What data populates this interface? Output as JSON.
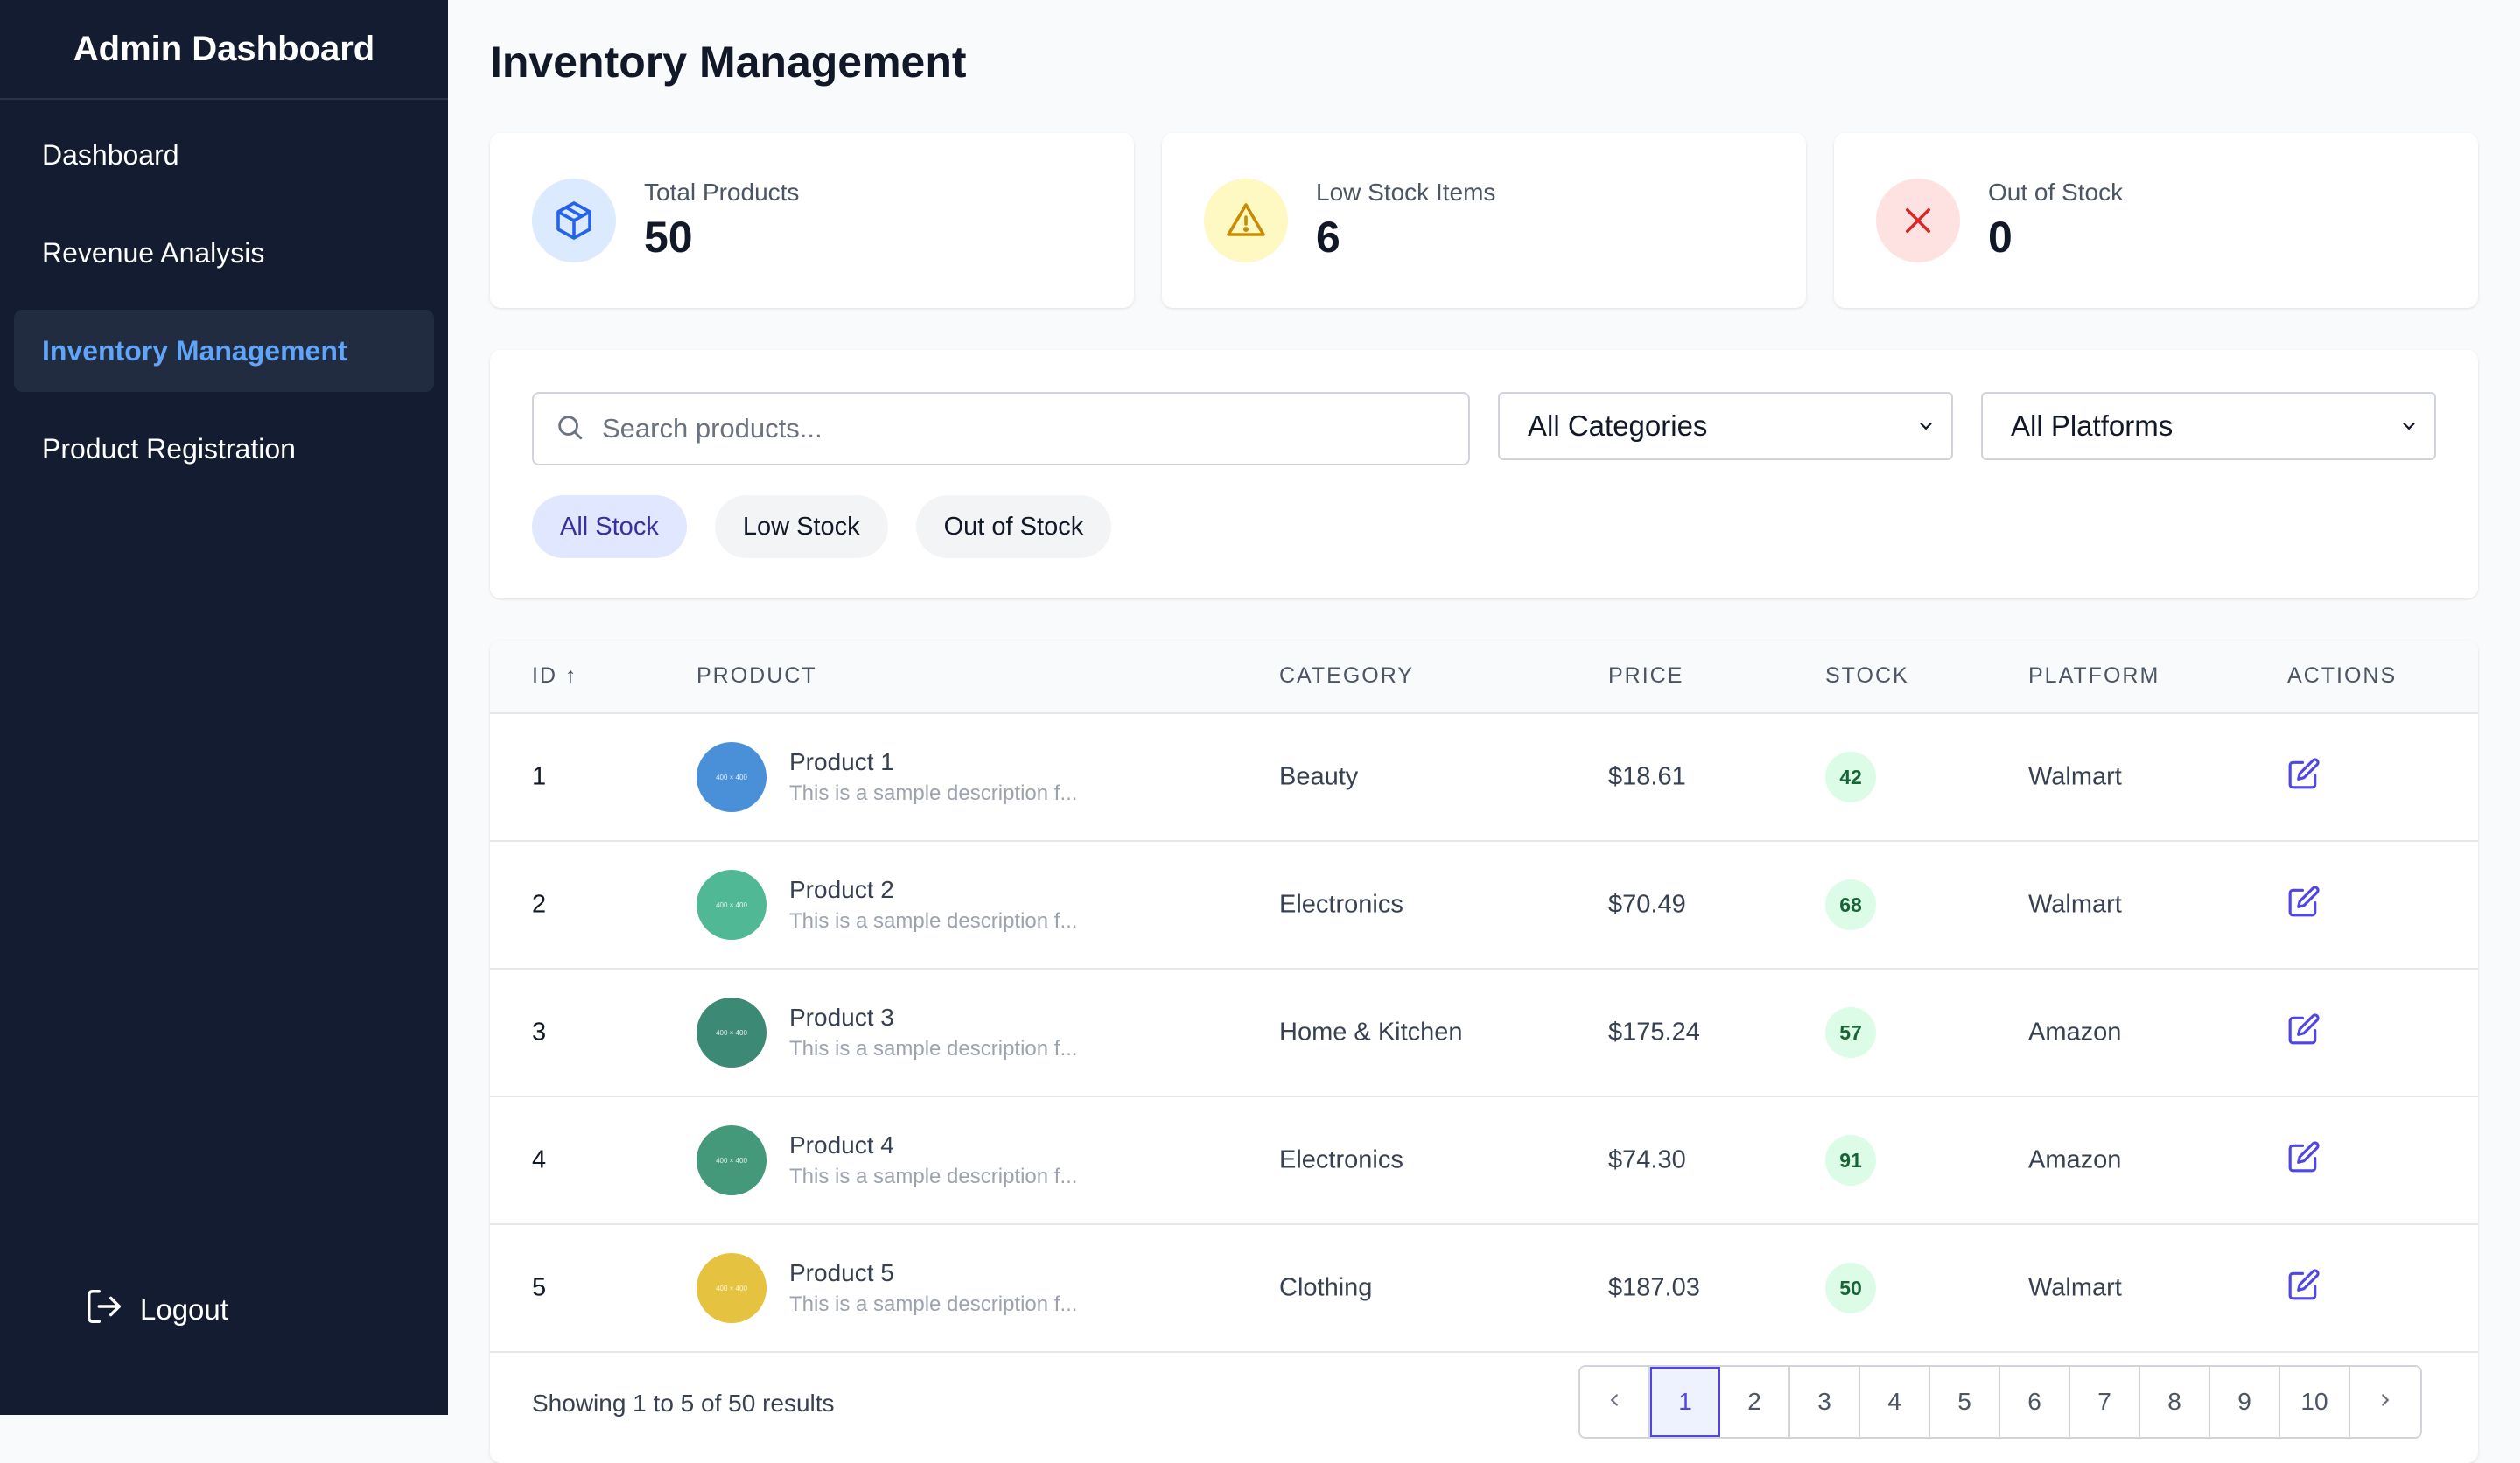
{
  "sidebar": {
    "brand": "Admin Dashboard",
    "items": [
      {
        "label": "Dashboard"
      },
      {
        "label": "Revenue Analysis"
      },
      {
        "label": "Inventory Management"
      },
      {
        "label": "Product Registration"
      }
    ],
    "active_index": 2,
    "logout_label": "Logout"
  },
  "page": {
    "title": "Inventory Management"
  },
  "stats": [
    {
      "label": "Total Products",
      "value": "50",
      "icon": "box-icon",
      "color": "#2563eb"
    },
    {
      "label": "Low Stock Items",
      "value": "6",
      "icon": "warning-icon",
      "color": "#ca8a04"
    },
    {
      "label": "Out of Stock",
      "value": "0",
      "icon": "x-icon",
      "color": "#dc2626"
    }
  ],
  "filters": {
    "search_placeholder": "Search products...",
    "category_selected": "All Categories",
    "platform_selected": "All Platforms",
    "chips": [
      "All Stock",
      "Low Stock",
      "Out of Stock"
    ],
    "active_chip": "All Stock"
  },
  "table": {
    "columns": [
      "ID",
      "PRODUCT",
      "CATEGORY",
      "PRICE",
      "STOCK",
      "PLATFORM",
      "ACTIONS"
    ],
    "sort_indicator": "↑",
    "rows": [
      {
        "id": "1",
        "name": "Product 1",
        "desc": "This is a sample description f...",
        "thumb_label": "400 × 400",
        "thumb_color": "#4a90d9",
        "category": "Beauty",
        "price": "$18.61",
        "stock": "42",
        "platform": "Walmart"
      },
      {
        "id": "2",
        "name": "Product 2",
        "desc": "This is a sample description f...",
        "thumb_label": "400 × 400",
        "thumb_color": "#50b894",
        "category": "Electronics",
        "price": "$70.49",
        "stock": "68",
        "platform": "Walmart"
      },
      {
        "id": "3",
        "name": "Product 3",
        "desc": "This is a sample description f...",
        "thumb_label": "400 × 400",
        "thumb_color": "#3c8a76",
        "category": "Home & Kitchen",
        "price": "$175.24",
        "stock": "57",
        "platform": "Amazon"
      },
      {
        "id": "4",
        "name": "Product 4",
        "desc": "This is a sample description f...",
        "thumb_label": "400 × 400",
        "thumb_color": "#43997a",
        "category": "Electronics",
        "price": "$74.30",
        "stock": "91",
        "platform": "Amazon"
      },
      {
        "id": "5",
        "name": "Product 5",
        "desc": "This is a sample description f...",
        "thumb_label": "400 × 400",
        "thumb_color": "#e5c23f",
        "category": "Clothing",
        "price": "$187.03",
        "stock": "50",
        "platform": "Walmart"
      }
    ]
  },
  "pagination": {
    "results_text": "Showing 1 to 5 of 50 results",
    "pages": [
      "1",
      "2",
      "3",
      "4",
      "5",
      "6",
      "7",
      "8",
      "9",
      "10"
    ],
    "current": "1"
  },
  "colors": {
    "sidebar_bg": "#131c30",
    "accent": "#60a5fa",
    "edit_icon": "#4f46e5"
  }
}
